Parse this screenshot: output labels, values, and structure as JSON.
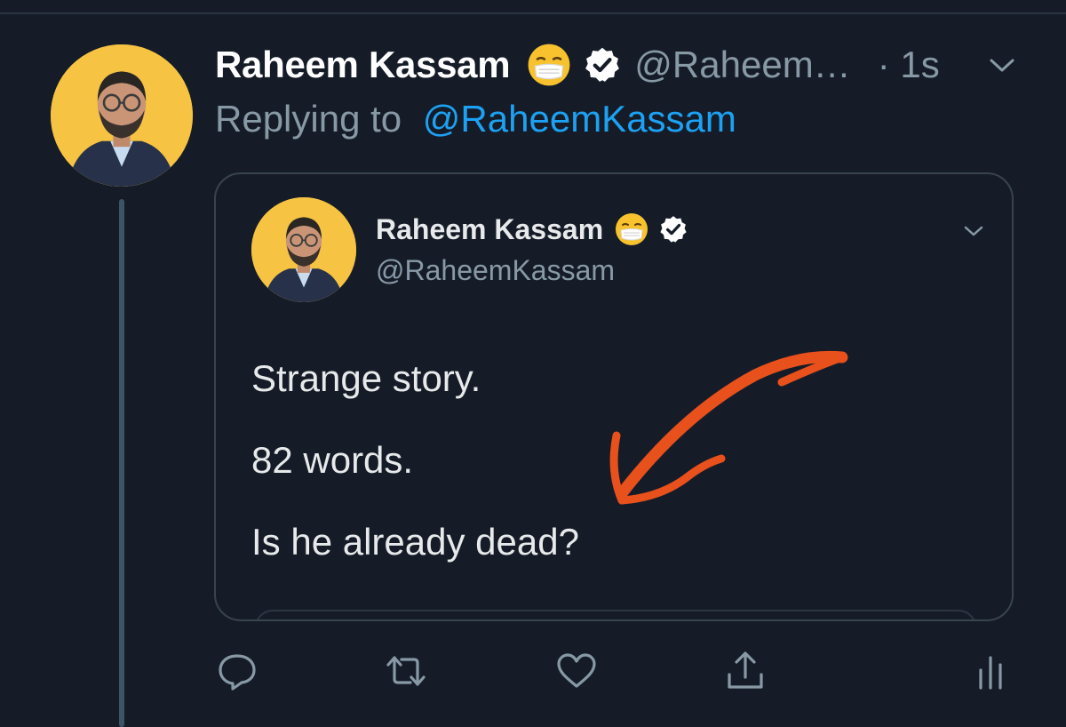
{
  "tweet": {
    "display_name": "Raheem Kassam",
    "handle": "@Raheem…",
    "timestamp": "· 1s",
    "replying_label": "Replying to",
    "replying_to": "@RaheemKassam"
  },
  "quoted_tweet": {
    "display_name": "Raheem Kassam",
    "handle": "@RaheemKassam",
    "lines": [
      "Strange story.",
      "82 words.",
      "Is he already dead?"
    ]
  },
  "icons": {
    "name_emoji": "face-with-medical-mask-icon",
    "verified": "verified-badge-icon",
    "menu": "chevron-down-icon",
    "actions": [
      "reply-icon",
      "retweet-icon",
      "like-icon",
      "share-icon",
      "analytics-icon"
    ]
  },
  "colors": {
    "background": "#151c28",
    "link": "#1da1f2",
    "secondary_text": "#8899a6",
    "annotation_arrow": "#e8501c",
    "avatar_background": "#f6c343"
  }
}
